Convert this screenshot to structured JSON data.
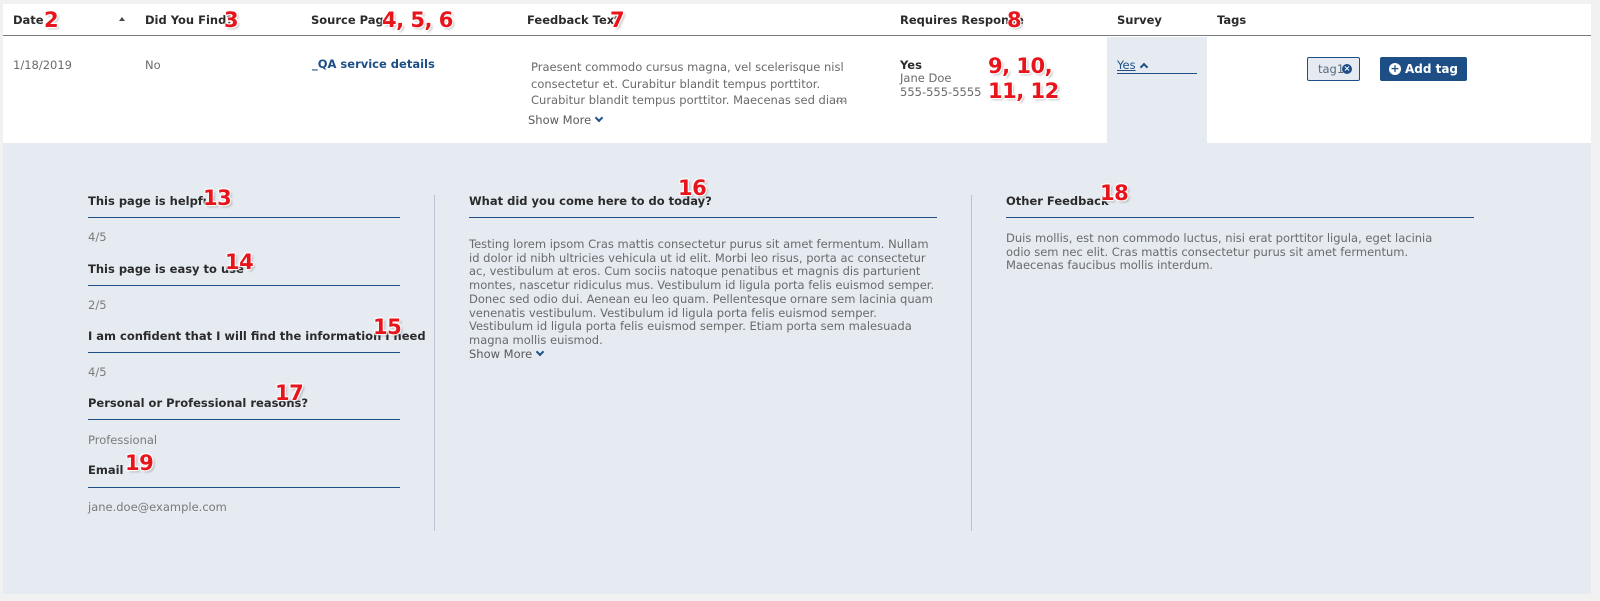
{
  "header": {
    "date": "Date",
    "did_you_find": "Did You Find?",
    "source_page": "Source Page",
    "feedback_text": "Feedback Text",
    "requires_response": "Requires Response",
    "survey": "Survey",
    "tags": "Tags"
  },
  "row": {
    "date": "1/18/2019",
    "did_you_find": "No",
    "source_page": "_QA service details",
    "feedback_text": "Praesent commodo cursus magna, vel scelerisque nisl consectetur et. Curabitur blandit tempus porttitor. Curabitur blandit tempus porttitor. Maecenas sed diam eget risus v",
    "feedback_ellipsis": "...",
    "show_more": "Show More",
    "requires_response": "Yes",
    "contact_name": "Jane Doe",
    "contact_phone": "555-555-5555",
    "survey": "Yes",
    "tag": "tag1",
    "add_tag": "Add tag"
  },
  "survey": {
    "questions": [
      {
        "label": "This page is helpful",
        "value": "4/5"
      },
      {
        "label": "This page is easy to use",
        "value": "2/5"
      },
      {
        "label": "I am confident that I will find the information I need",
        "value": "4/5"
      },
      {
        "label": "Personal or Professional reasons?",
        "value": "Professional"
      },
      {
        "label": "Email",
        "value": "jane.doe@example.com"
      }
    ],
    "what_did_you_come": {
      "label": "What did you come here to do today?",
      "text": "Testing lorem ipsom Cras mattis consectetur purus sit amet fermentum. Nullam id dolor id nibh ultricies vehicula ut id elit. Morbi leo risus, porta ac consectetur ac, vestibulum at eros. Cum sociis natoque penatibus et magnis dis parturient montes, nascetur ridiculus mus. Vestibulum id ligula porta felis euismod semper. Donec sed odio dui. Aenean eu leo quam. Pellentesque ornare sem lacinia quam venenatis vestibulum. Vestibulum id ligula porta felis euismod semper. Vestibulum id ligula porta felis euismod semper. Etiam porta sem malesuada magna mollis euismod.",
      "show_more": "Show More"
    },
    "other_feedback": {
      "label": "Other Feedback",
      "text": "Duis mollis, est non commodo luctus, nisi erat porttitor ligula, eget lacinia odio sem nec elit. Cras mattis consectetur purus sit amet fermentum. Maecenas faucibus mollis interdum."
    }
  },
  "annotations": {
    "a2": "2",
    "a3": "3",
    "a4": "4, 5, 6",
    "a7": "7",
    "a8": "8",
    "a9": "9, 10,",
    "a11": "11, 12",
    "a13": "13",
    "a14": "14",
    "a15": "15",
    "a16": "16",
    "a17": "17",
    "a18": "18",
    "a19": "19"
  },
  "colors": {
    "accent": "#1d4f86",
    "panel_bg": "#e6ebf2",
    "annotation": "#e8141b"
  }
}
